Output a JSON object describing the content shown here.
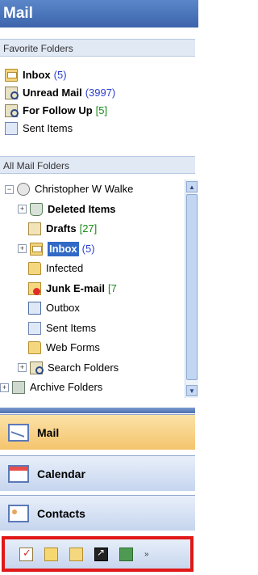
{
  "title": "Mail",
  "favorites": {
    "header": "Favorite Folders",
    "items": [
      {
        "label": "Inbox",
        "count": "(5)",
        "count_color": "blue",
        "bold": true,
        "icon": "inbox-folder-icon"
      },
      {
        "label": "Unread Mail",
        "count": "(3997)",
        "count_color": "blue",
        "bold": true,
        "icon": "search-folder-icon"
      },
      {
        "label": "For Follow Up",
        "count": "[5]",
        "count_color": "green",
        "bold": true,
        "icon": "search-folder-icon"
      },
      {
        "label": "Sent Items",
        "count": "",
        "bold": false,
        "icon": "sent-items-icon"
      }
    ]
  },
  "all_folders": {
    "header": "All Mail Folders",
    "items": [
      {
        "label": "Christopher W Walke",
        "count": "",
        "bold": false,
        "icon": "mailbox-root-icon",
        "indent": 0,
        "expander": "−"
      },
      {
        "label": "Deleted Items",
        "count": "",
        "bold": true,
        "icon": "deleted-items-icon",
        "indent": 1,
        "expander": "+"
      },
      {
        "label": "Drafts",
        "count": "[27]",
        "count_color": "green",
        "bold": true,
        "icon": "drafts-icon",
        "indent": 1,
        "expander": ""
      },
      {
        "label": "Inbox",
        "count": "(5)",
        "count_color": "blue",
        "bold": true,
        "icon": "inbox-folder-icon",
        "indent": 1,
        "expander": "+",
        "selected": true
      },
      {
        "label": "Infected",
        "count": "",
        "bold": false,
        "icon": "folder-icon",
        "indent": 1,
        "expander": ""
      },
      {
        "label": "Junk E-mail",
        "count": "[7",
        "count_color": "green",
        "bold": true,
        "icon": "junk-mail-icon",
        "indent": 1,
        "expander": ""
      },
      {
        "label": "Outbox",
        "count": "",
        "bold": false,
        "icon": "outbox-icon",
        "indent": 1,
        "expander": ""
      },
      {
        "label": "Sent Items",
        "count": "",
        "bold": false,
        "icon": "sent-items-icon",
        "indent": 1,
        "expander": ""
      },
      {
        "label": "Web Forms",
        "count": "",
        "bold": false,
        "icon": "folder-icon",
        "indent": 1,
        "expander": ""
      },
      {
        "label": "Search Folders",
        "count": "",
        "bold": false,
        "icon": "search-folder-icon",
        "indent": 1,
        "expander": "+"
      },
      {
        "label": "Archive Folders",
        "count": "",
        "bold": false,
        "icon": "archive-icon",
        "indent": 0,
        "expander": "+"
      }
    ]
  },
  "nav_buttons": [
    {
      "label": "Mail",
      "icon": "mail-icon",
      "active": true
    },
    {
      "label": "Calendar",
      "icon": "calendar-icon",
      "active": false
    },
    {
      "label": "Contacts",
      "icon": "contacts-icon",
      "active": false
    }
  ],
  "bottom_bar": {
    "icons": [
      "tasks-icon",
      "notes-icon",
      "folder-list-icon",
      "shortcuts-icon",
      "journal-icon"
    ],
    "more": "»"
  },
  "colors": {
    "title_bg": "#3c65ad",
    "count_blue": "#2a3fcf",
    "count_green": "#188a18",
    "selected_bg": "#3169c6",
    "mail_active": "#f4c46c",
    "bottom_highlight": "#e01818"
  }
}
